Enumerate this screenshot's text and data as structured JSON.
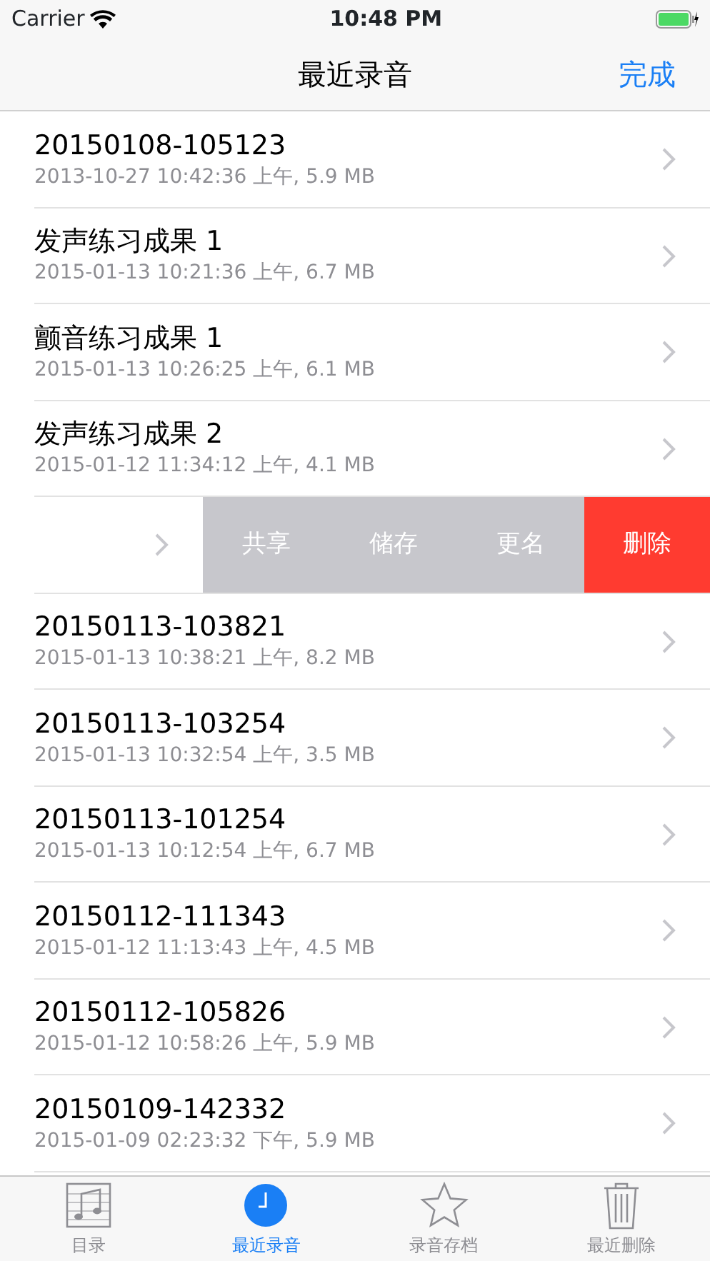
{
  "status_bar": {
    "carrier": "Carrier",
    "time": "10:48 PM"
  },
  "nav": {
    "title": "最近录音",
    "done": "完成"
  },
  "rows": [
    {
      "kind": "normal",
      "title": "20150108-105123",
      "detail": "2013-10-27 10:42:36 上午, 5.9 MB"
    },
    {
      "kind": "normal",
      "title": "发声练习成果 1",
      "detail": "2015-01-13 10:21:36 上午, 6.7 MB"
    },
    {
      "kind": "normal",
      "title": "颤音练习成果 1",
      "detail": "2015-01-13 10:26:25 上午, 6.1 MB"
    },
    {
      "kind": "normal",
      "title": "发声练习成果 2",
      "detail": "2015-01-12 11:34:12 上午, 4.1 MB"
    },
    {
      "kind": "swiped",
      "actions": [
        {
          "label": "共享",
          "kind": "normal"
        },
        {
          "label": "储存",
          "kind": "normal"
        },
        {
          "label": "更名",
          "kind": "normal"
        },
        {
          "label": "删除",
          "kind": "destructive"
        }
      ]
    },
    {
      "kind": "normal",
      "title": "20150113-103821",
      "detail": "2015-01-13 10:38:21 上午, 8.2 MB"
    },
    {
      "kind": "normal",
      "title": "20150113-103254",
      "detail": "2015-01-13 10:32:54 上午, 3.5 MB"
    },
    {
      "kind": "normal",
      "title": "20150113-101254",
      "detail": "2015-01-13 10:12:54 上午, 6.7 MB"
    },
    {
      "kind": "normal",
      "title": "20150112-111343",
      "detail": "2015-01-12 11:13:43 上午, 4.5 MB"
    },
    {
      "kind": "normal",
      "title": "20150112-105826",
      "detail": "2015-01-12 10:58:26 上午, 5.9 MB"
    },
    {
      "kind": "normal",
      "title": "20150109-142332",
      "detail": "2015-01-09 02:23:32 下午, 5.9 MB"
    }
  ],
  "tabs": [
    {
      "label": "目录",
      "selected": false
    },
    {
      "label": "最近录音",
      "selected": true
    },
    {
      "label": "录音存档",
      "selected": false
    },
    {
      "label": "最近删除",
      "selected": false
    }
  ]
}
